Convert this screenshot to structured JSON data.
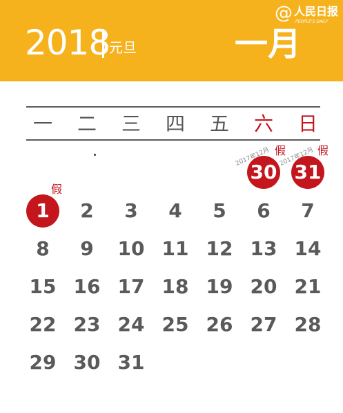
{
  "header": {
    "year": "2018",
    "holiday_name": "元旦",
    "month": "一月",
    "logo_mark": "@",
    "logo_name": "人民日报",
    "logo_en": "PEOPLE'S DAILY"
  },
  "weekdays": [
    "一",
    "二",
    "三",
    "四",
    "五",
    "六",
    "日"
  ],
  "prev_month": {
    "days": [
      "30",
      "31"
    ],
    "labels": [
      "2017年12月",
      "2017年12月"
    ],
    "tags": [
      "假",
      "假"
    ]
  },
  "days": [
    "1",
    "2",
    "3",
    "4",
    "5",
    "6",
    "7",
    "8",
    "9",
    "10",
    "11",
    "12",
    "13",
    "14",
    "15",
    "16",
    "17",
    "18",
    "19",
    "20",
    "21",
    "22",
    "23",
    "24",
    "25",
    "26",
    "27",
    "28",
    "29",
    "30",
    "31"
  ],
  "day1_tag": "假",
  "colors": {
    "accent_orange": "#f6b21c",
    "holiday_red": "#c3161d",
    "text_gray": "#5a5a5a"
  }
}
